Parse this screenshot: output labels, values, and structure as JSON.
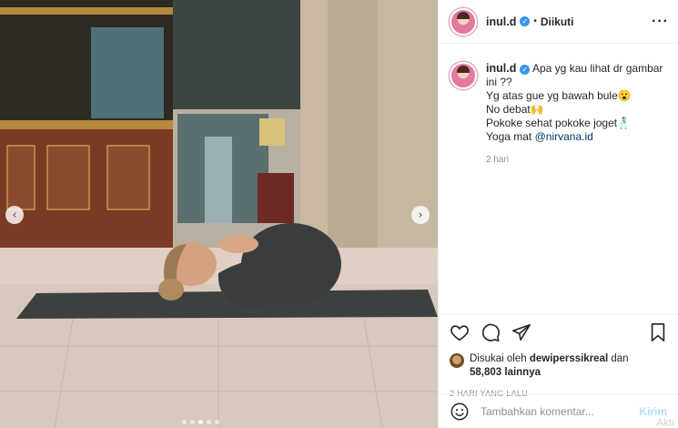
{
  "post": {
    "username": "inul.d",
    "follow_status": "Diikuti",
    "separator": "•",
    "more_icon": "more-horizontal-icon",
    "caption": {
      "line1": "Apa yg kau lihat dr gambar ini ??",
      "line2": "Yg atas gue yg bawah bule😮",
      "line3": "No debat🙌",
      "line4": "Pokoke sehat pokoke joget🕺",
      "line5_prefix": "Yoga mat ",
      "mention": "@nirvana.id"
    },
    "caption_time": "2 hari",
    "likes": {
      "prefix": "Disukai oleh",
      "liker": "dewiperssikreal",
      "joiner": "dan",
      "count": "58,803 lainnya"
    },
    "posted_ago": "2 HARI YANG LALU",
    "comment_placeholder": "Tambahkan komentar...",
    "post_button": "Kirim",
    "watermark": "Akti"
  },
  "carousel": {
    "prev_icon": "‹",
    "next_icon": "›",
    "dots_count": 5,
    "active_dot": 2
  },
  "colors": {
    "verified": "#3897f0",
    "link": "#00376b",
    "post_button": "#b2dffc",
    "muted": "#8e8e8e"
  }
}
